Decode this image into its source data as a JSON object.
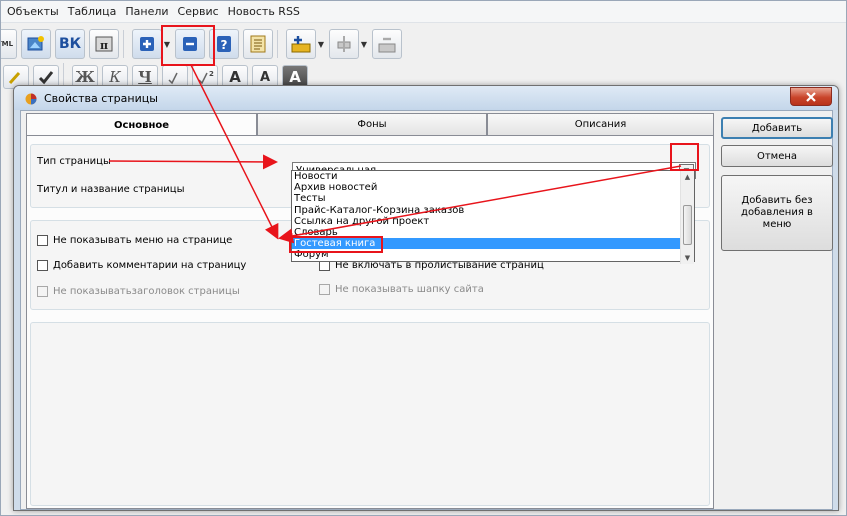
{
  "menubar": {
    "items": [
      "Объекты",
      "Таблица",
      "Панели",
      "Сервис",
      "Новость RSS"
    ]
  },
  "toolbar": {
    "html_label": "HTML",
    "vk_label": "ВК",
    "format_buttons": [
      "Ж",
      "К",
      "Ч",
      "A",
      "A",
      "A"
    ]
  },
  "dialog": {
    "title": "Свойства страницы",
    "tabs": [
      {
        "label": "Основное",
        "active": true
      },
      {
        "label": "Фоны",
        "active": false
      },
      {
        "label": "Описания",
        "active": false
      }
    ],
    "page_type_label": "Тип страницы",
    "page_title_label": "Титул и название страницы",
    "page_type_value": "Универсальная",
    "dropdown_options": [
      "Новости",
      "Архив новостей",
      "Тесты",
      "Прайс-Каталог-Корзина заказов",
      "Ссылка на другой проект",
      "Словарь",
      "Гостевая книга",
      "Форум"
    ],
    "dropdown_selected": "Гостевая книга",
    "checkboxes": {
      "hide_menu": "Не показывать меню на странице",
      "add_comments": "Добавить комментарии на страницу",
      "hide_header": "Не показыватьзаголовок страницы",
      "exclude_paging": "Не включать в пролистывание страниц",
      "hide_site_header": "Не показывать шапку сайта"
    },
    "buttons": {
      "add": "Добавить",
      "cancel": "Отмена",
      "add_without_menu": "Добавить без добавления в меню"
    }
  },
  "colors": {
    "annotation_red": "#e8141b",
    "selection_blue": "#3399ff",
    "close_button": "#c9452b"
  },
  "icons": {
    "app_icon": "pie-chart-icon",
    "close": "close-icon"
  }
}
